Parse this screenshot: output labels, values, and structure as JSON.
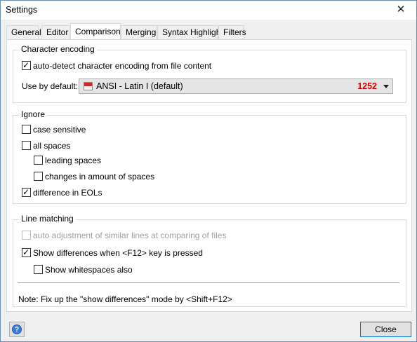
{
  "window": {
    "title": "Settings",
    "close_glyph": "✕"
  },
  "tabs": [
    {
      "label": "General"
    },
    {
      "label": "Editor"
    },
    {
      "label": "Comparison",
      "active": true
    },
    {
      "label": "Merging"
    },
    {
      "label": "Syntax Highlight"
    },
    {
      "label": "Filters"
    }
  ],
  "encoding": {
    "group_title": "Character encoding",
    "auto_detect": {
      "label": "auto-detect character encoding from file content",
      "checked": true
    },
    "default_label": "Use by default:",
    "default_value": "ANSI - Latin I (default)",
    "code_page": "1252",
    "flag_icon": "flag-icon"
  },
  "ignore": {
    "group_title": "Ignore",
    "case_sensitive": {
      "label": "case sensitive",
      "checked": false
    },
    "all_spaces": {
      "label": "all spaces",
      "checked": false
    },
    "leading_spaces": {
      "label": "leading spaces",
      "checked": false
    },
    "changes_spaces": {
      "label": "changes in amount of spaces",
      "checked": false
    },
    "eols": {
      "label": "difference in EOLs",
      "checked": true
    }
  },
  "line_matching": {
    "group_title": "Line matching",
    "auto_adjust": {
      "label": "auto adjustment of similar lines at comparing of files",
      "checked": false,
      "disabled": true
    },
    "show_diff": {
      "label": "Show differences when <F12> key is pressed",
      "checked": true
    },
    "show_ws": {
      "label": "Show whitespaces also",
      "checked": false
    },
    "note": "Note: Fix up the \"show differences\" mode by <Shift+F12>"
  },
  "footer": {
    "help_glyph": "?",
    "close_label": "Close"
  },
  "colors": {
    "accent": "#0078d7",
    "code_page": "#d00000"
  },
  "check_glyph": "✓"
}
